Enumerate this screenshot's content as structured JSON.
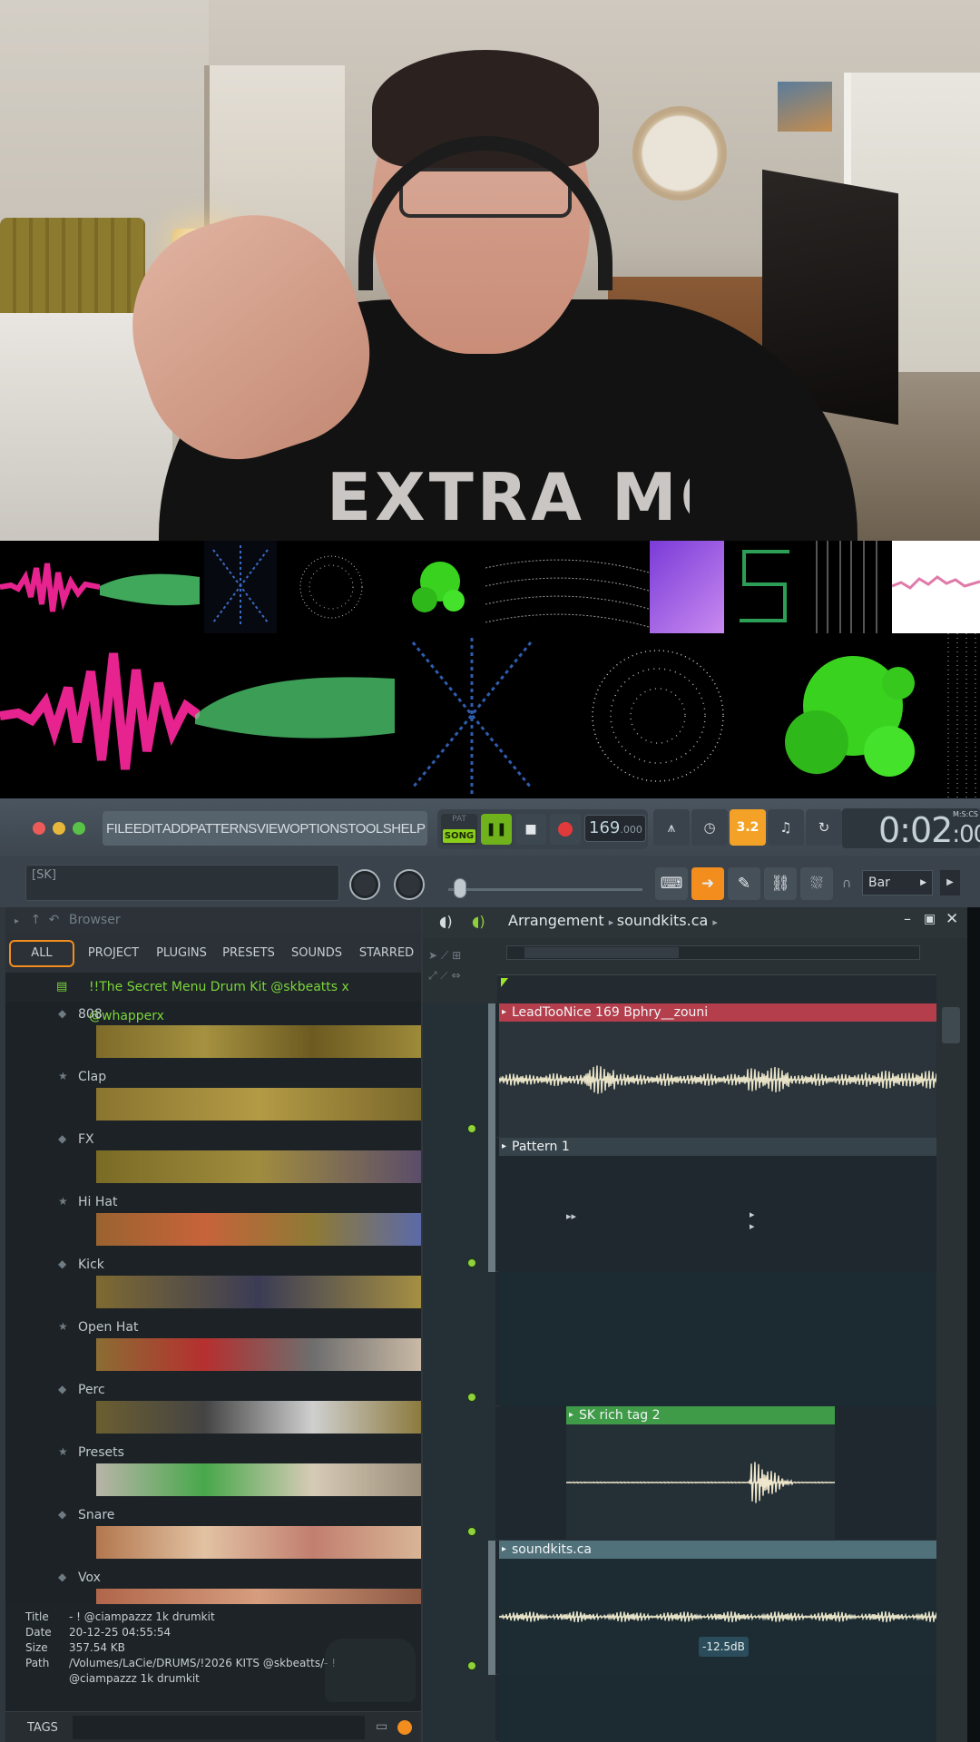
{
  "webcam": {
    "shirt_text": "EXTRA MODE"
  },
  "fl": {
    "menu": [
      "FILE",
      "EDIT",
      "ADD",
      "PATTERNS",
      "VIEW",
      "OPTIONS",
      "TOOLS",
      "HELP"
    ],
    "transport": {
      "pat_label": "PAT",
      "song_label": "SONG",
      "tempo": "169",
      "tempo_fraction": ".000"
    },
    "metronome_label": "3.2",
    "time": {
      "main": "0:02",
      "sub": ":00",
      "unit_label": "M:S:CS"
    },
    "hint_text": "[SK]",
    "snap": "Bar",
    "colors": {
      "accent_orange": "#f28d1e",
      "song_green": "#8acd1b",
      "folder_green": "#7bd63a"
    }
  },
  "browser": {
    "header": "Browser",
    "tabs": [
      "ALL",
      "PROJECT",
      "PLUGINS",
      "PRESETS",
      "SOUNDS",
      "STARRED"
    ],
    "root_folder": "!!The Secret Menu Drum Kit @skbeatts x @whapperx",
    "folders": [
      {
        "name": "808",
        "icon": "diamond"
      },
      {
        "name": "Clap",
        "icon": "star"
      },
      {
        "name": "FX",
        "icon": "diamond"
      },
      {
        "name": "Hi Hat",
        "icon": "star"
      },
      {
        "name": "Kick",
        "icon": "diamond"
      },
      {
        "name": "Open Hat",
        "icon": "star"
      },
      {
        "name": "Perc",
        "icon": "diamond"
      },
      {
        "name": "Presets",
        "icon": "star"
      },
      {
        "name": "Snare",
        "icon": "diamond"
      },
      {
        "name": "Vox",
        "icon": "diamond"
      }
    ],
    "info": {
      "title_key": "Title",
      "title_val": "- ! @ciampazzz 1k drumkit",
      "date_key": "Date",
      "date_val": "20-12-25 04:55:54",
      "size_key": "Size",
      "size_val": "357.54 KB",
      "path_key": "Path",
      "path_val": "/Volumes/LaCie/DRUMS/!2026 KITS @skbeatts/- ! @ciampazzz 1k drumkit"
    },
    "tags_label": "TAGS"
  },
  "playlist": {
    "breadcrumb": [
      "Arrangement",
      "soundkits.ca"
    ],
    "clips": [
      {
        "title": "LeadTooNice 169 Bphry__zouni"
      },
      {
        "title": "Pattern 1"
      },
      {
        "title": "SK rich tag 2"
      },
      {
        "title": "soundkits.ca"
      }
    ],
    "volume_label": "-12.5dB"
  }
}
